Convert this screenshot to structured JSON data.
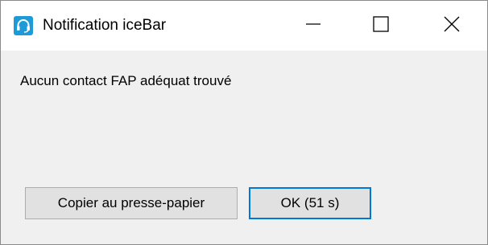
{
  "window": {
    "title": "Notification iceBar",
    "app_icon": "headset-icon",
    "accent_color": "#1e9bd7",
    "controls": {
      "minimize": "minimize-icon",
      "maximize": "maximize-icon",
      "close": "close-icon"
    }
  },
  "dialog": {
    "message": "Aucun contact FAP adéquat trouvé",
    "copy_button_label": "Copier au presse-papier",
    "ok_button_label": "OK (51 s)",
    "focused_button_border_color": "#0078d7"
  }
}
